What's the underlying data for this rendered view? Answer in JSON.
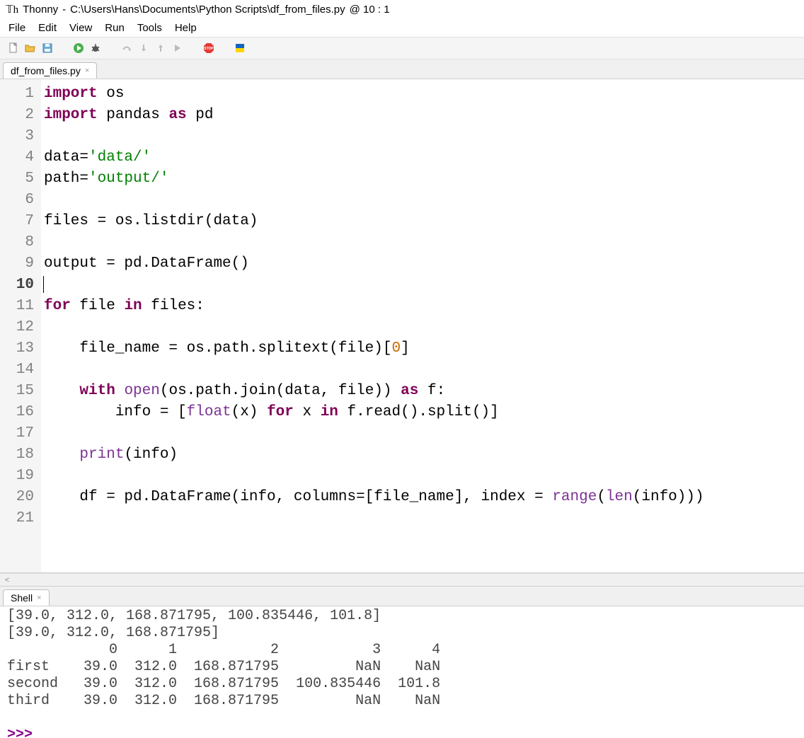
{
  "title": {
    "app": "Thonny",
    "sep": "  -  ",
    "path": "C:\\Users\\Hans\\Documents\\Python Scripts\\df_from_files.py",
    "cursor": "  @  10 : 1"
  },
  "menu": [
    "File",
    "Edit",
    "View",
    "Run",
    "Tools",
    "Help"
  ],
  "toolbar_icons": [
    "new-file-icon",
    "open-file-icon",
    "save-icon",
    "spacer",
    "run-icon",
    "debug-icon",
    "spacer",
    "step-over-icon",
    "step-into-icon",
    "step-out-icon",
    "resume-icon",
    "spacer",
    "stop-icon",
    "spacer",
    "flag-icon"
  ],
  "editor_tab": {
    "label": "df_from_files.py"
  },
  "code_lines": [
    {
      "n": 1,
      "html": "<span class='kw'>import</span> os"
    },
    {
      "n": 2,
      "html": "<span class='kw'>import</span> pandas <span class='kw'>as</span> pd"
    },
    {
      "n": 3,
      "html": ""
    },
    {
      "n": 4,
      "html": "data=<span class='str'>'data/'</span>"
    },
    {
      "n": 5,
      "html": "path=<span class='str'>'output/'</span>"
    },
    {
      "n": 6,
      "html": ""
    },
    {
      "n": 7,
      "html": "files = os.listdir(data)"
    },
    {
      "n": 8,
      "html": ""
    },
    {
      "n": 9,
      "html": "output = pd.DataFrame()"
    },
    {
      "n": 10,
      "html": "",
      "current": true
    },
    {
      "n": 11,
      "html": "<span class='kw'>for</span> file <span class='kw'>in</span> files:"
    },
    {
      "n": 12,
      "html": ""
    },
    {
      "n": 13,
      "html": "    file_name = os.path.splitext(file)[<span class='num'>0</span>]"
    },
    {
      "n": 14,
      "html": ""
    },
    {
      "n": 15,
      "html": "    <span class='kw'>with</span> <span class='builtin'>open</span>(os.path.join(data, file)) <span class='kw'>as</span> f:"
    },
    {
      "n": 16,
      "html": "        info = [<span class='builtin'>float</span>(x) <span class='kw'>for</span> x <span class='kw'>in</span> f.read().split()]"
    },
    {
      "n": 17,
      "html": ""
    },
    {
      "n": 18,
      "html": "    <span class='builtin'>print</span>(info)"
    },
    {
      "n": 19,
      "html": ""
    },
    {
      "n": 20,
      "html": "    df = pd.DataFrame(info, columns=[file_name], index = <span class='builtin'>range</span>(<span class='builtin'>len</span>(info)))"
    },
    {
      "n": 21,
      "html": ""
    }
  ],
  "shell_tab": {
    "label": "Shell"
  },
  "shell_lines": [
    "[39.0, 312.0, 168.871795, 100.835446, 101.8]",
    "[39.0, 312.0, 168.871795]",
    "            0      1           2           3      4",
    "first    39.0  312.0  168.871795         NaN    NaN",
    "second   39.0  312.0  168.871795  100.835446  101.8",
    "third    39.0  312.0  168.871795         NaN    NaN"
  ],
  "shell_prompt": ">>> "
}
